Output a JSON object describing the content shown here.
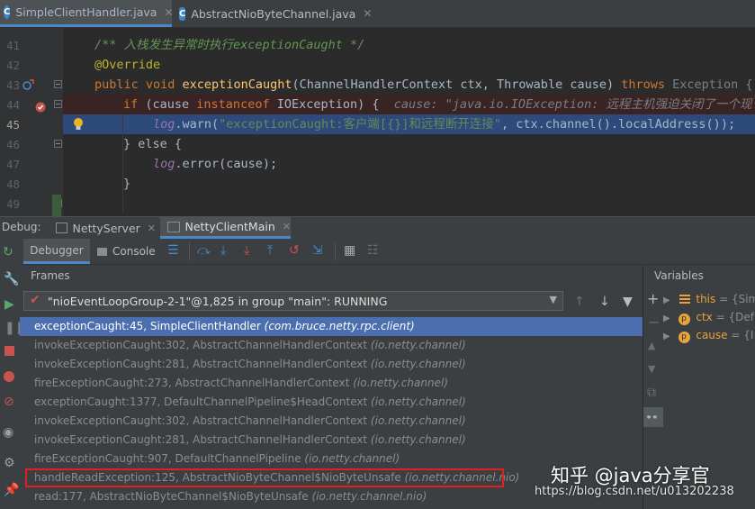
{
  "editor_tabs": [
    {
      "label": "SimpleClientHandler.java",
      "icon": "class-icon"
    },
    {
      "label": "AbstractNioByteChannel.java",
      "icon": "class-icon"
    }
  ],
  "line_numbers": [
    "41",
    "42",
    "43",
    "44",
    "45",
    "46",
    "47",
    "48",
    "49"
  ],
  "code": {
    "l41": "/** 入栈发生异常时执行exceptionCaught */",
    "l42": "@Override",
    "l43_kw1": "public void ",
    "l43_fn": "exceptionCaught",
    "l43_rest": "(ChannelHandlerContext ctx, Throwable cause) ",
    "l43_throws": "throws ",
    "l43_exc": "Exception {",
    "l44_if": "if ",
    "l44_a": "(cause ",
    "l44_inst": "instanceof ",
    "l44_b": "IOException) {",
    "l44_hint": "cause: \"java.io.IOException: 远程主机强迫关闭了一个现",
    "l45_log": "log",
    "l45_a": ".warn(",
    "l45_str": "\"exceptionCaught:客户端[{}]和远程断开连接\"",
    "l45_b": ", ctx.channel().localAddress());",
    "l45_hint": "c",
    "l46": "} else {",
    "l47_log": "log",
    "l47_rest": ".error(cause);",
    "l48": "}"
  },
  "debug": {
    "label": "Debug:",
    "tabs": [
      "NettyServer",
      "NettyClientMain"
    ],
    "toolbar": {
      "debugger": "Debugger",
      "console": "Console"
    },
    "frames_header": "Frames",
    "variables_header": "Variables",
    "thread": "\"nioEventLoopGroup-2-1\"@1,825 in group \"main\": RUNNING"
  },
  "frames": [
    {
      "method": "exceptionCaught:45, SimpleClientHandler",
      "pkg": "(com.bruce.netty.rpc.client)"
    },
    {
      "method": "invokeExceptionCaught:302, AbstractChannelHandlerContext",
      "pkg": "(io.netty.channel)"
    },
    {
      "method": "invokeExceptionCaught:281, AbstractChannelHandlerContext",
      "pkg": "(io.netty.channel)"
    },
    {
      "method": "fireExceptionCaught:273, AbstractChannelHandlerContext",
      "pkg": "(io.netty.channel)"
    },
    {
      "method": "exceptionCaught:1377, DefaultChannelPipeline$HeadContext",
      "pkg": "(io.netty.channel)"
    },
    {
      "method": "invokeExceptionCaught:302, AbstractChannelHandlerContext",
      "pkg": "(io.netty.channel)"
    },
    {
      "method": "invokeExceptionCaught:281, AbstractChannelHandlerContext",
      "pkg": "(io.netty.channel)"
    },
    {
      "method": "fireExceptionCaught:907, DefaultChannelPipeline",
      "pkg": "(io.netty.channel)"
    },
    {
      "method": "handleReadException:125, AbstractNioByteChannel$NioByteUnsafe",
      "pkg": "(io.netty.channel.nio)"
    },
    {
      "method": "read:177, AbstractNioByteChannel$NioByteUnsafe",
      "pkg": "(io.netty.channel.nio)"
    }
  ],
  "variables": [
    {
      "name": "this",
      "value": "= {Sim"
    },
    {
      "name": "ctx",
      "value": "= {Def"
    },
    {
      "name": "cause",
      "value": "= {I"
    }
  ],
  "watermark": {
    "brand": "知乎 @java分享官",
    "url": "https://blog.csdn.net/u013202238"
  },
  "colors": {
    "selection": "#4b6eaf",
    "highlight_box": "#e0211d",
    "error_line": "#3a2323",
    "exec_line": "#2d4a7a"
  }
}
